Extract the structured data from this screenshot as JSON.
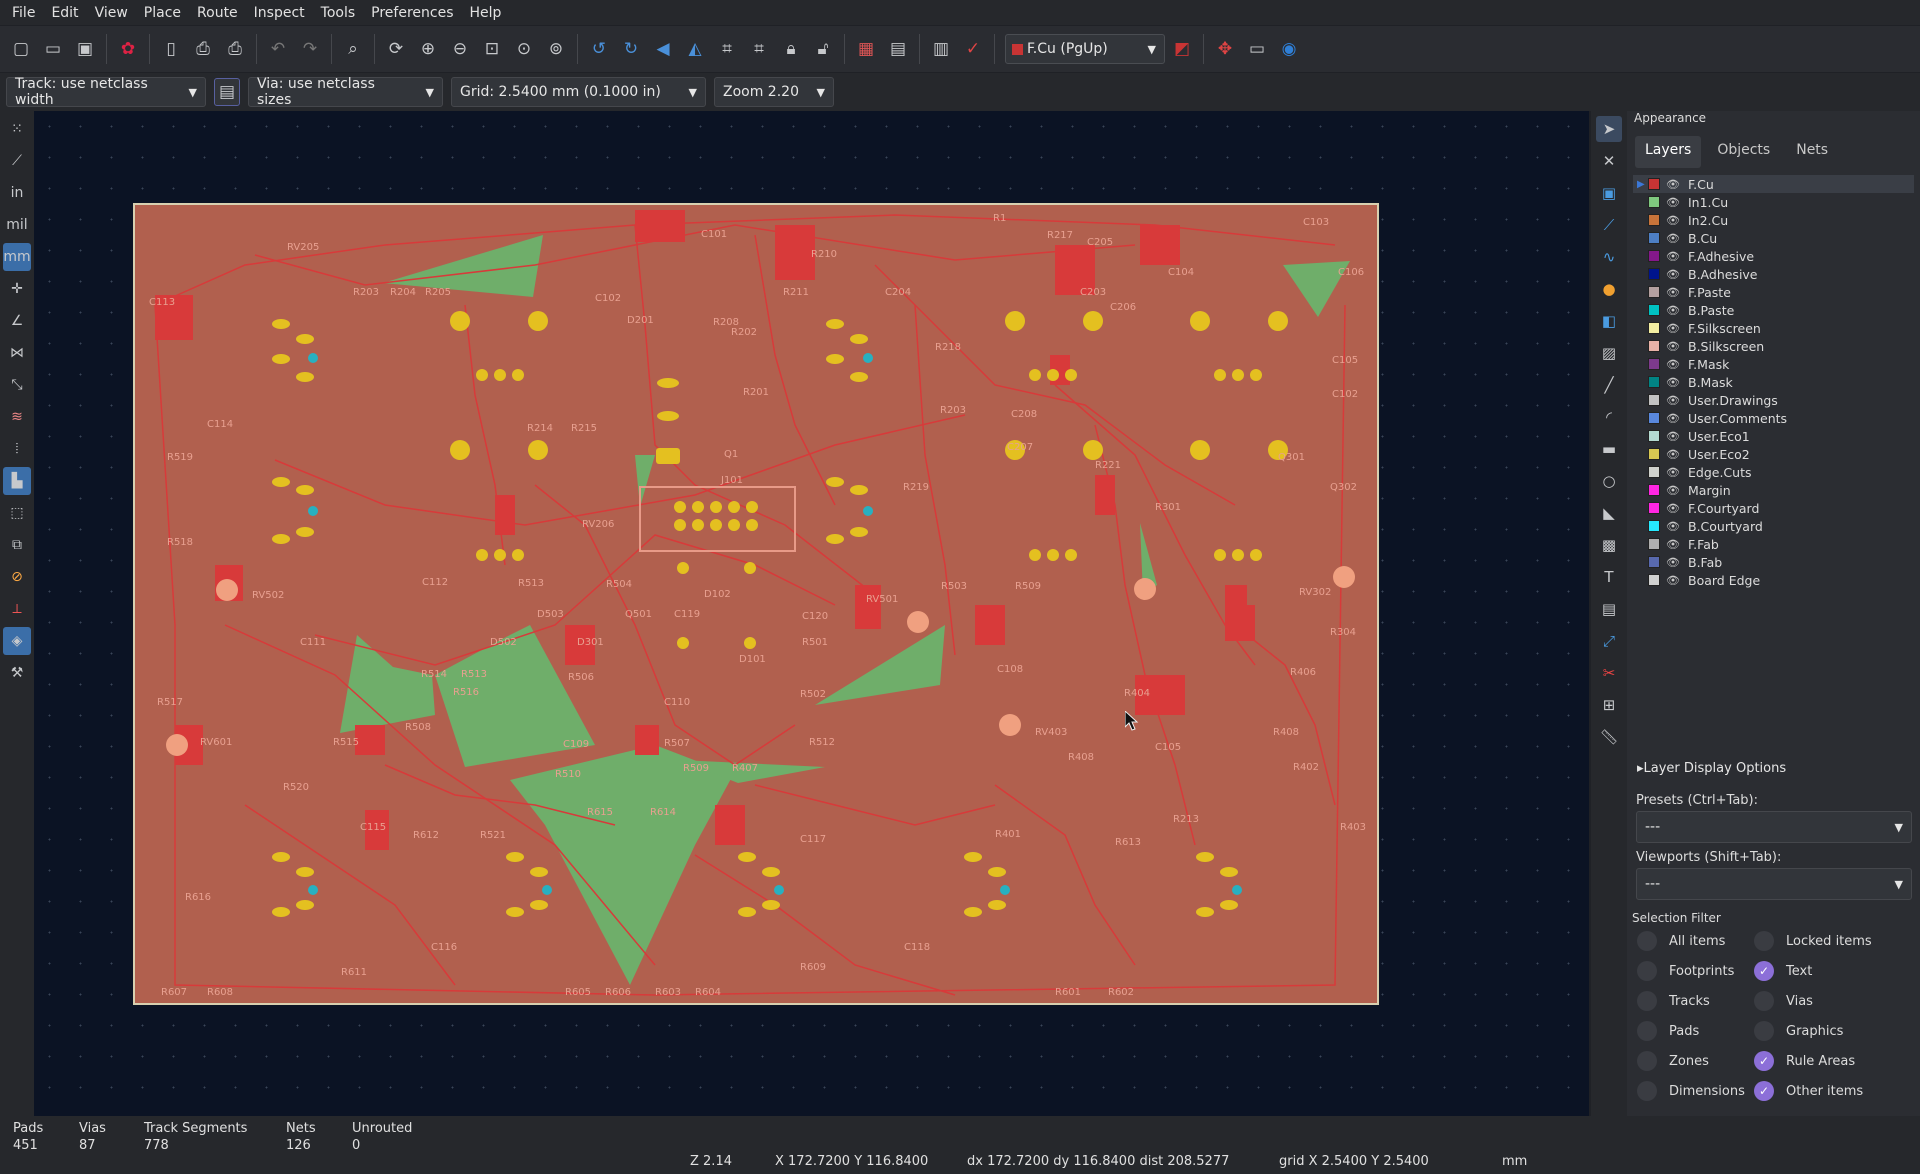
{
  "menu": [
    "File",
    "Edit",
    "View",
    "Place",
    "Route",
    "Inspect",
    "Tools",
    "Preferences",
    "Help"
  ],
  "toolbar": {
    "layer_select": "F.Cu (PgUp)",
    "layer_color": "#c83434"
  },
  "options": {
    "track": "Track: use netclass width",
    "via": "Via: use netclass sizes",
    "grid": "Grid: 2.5400 mm (0.1000 in)",
    "zoom": "Zoom 2.20"
  },
  "left_toolbar": {
    "units_in": "in",
    "units_mil": "mil",
    "units_mm": "mm"
  },
  "appearance": {
    "title": "Appearance",
    "tabs": [
      "Layers",
      "Objects",
      "Nets"
    ],
    "layers": [
      {
        "name": "F.Cu",
        "color": "#c83434"
      },
      {
        "name": "In1.Cu",
        "color": "#7fc87f"
      },
      {
        "name": "In2.Cu",
        "color": "#c8743a"
      },
      {
        "name": "B.Cu",
        "color": "#4d7fc4"
      },
      {
        "name": "F.Adhesive",
        "color": "#84188a"
      },
      {
        "name": "B.Adhesive",
        "color": "#00148c"
      },
      {
        "name": "F.Paste",
        "color": "#b4a0a0"
      },
      {
        "name": "B.Paste",
        "color": "#00c2c2"
      },
      {
        "name": "F.Silkscreen",
        "color": "#f2eda1"
      },
      {
        "name": "B.Silkscreen",
        "color": "#e8b2a7"
      },
      {
        "name": "F.Mask",
        "color": "#7d3a8c"
      },
      {
        "name": "B.Mask",
        "color": "#018484"
      },
      {
        "name": "User.Drawings",
        "color": "#c2c2c2"
      },
      {
        "name": "User.Comments",
        "color": "#5988dd"
      },
      {
        "name": "User.Eco1",
        "color": "#b4dbd2"
      },
      {
        "name": "User.Eco2",
        "color": "#d8c852"
      },
      {
        "name": "Edge.Cuts",
        "color": "#d0d2cd"
      },
      {
        "name": "Margin",
        "color": "#ff26e2"
      },
      {
        "name": "F.Courtyard",
        "color": "#ff26e2"
      },
      {
        "name": "B.Courtyard",
        "color": "#26e9ff"
      },
      {
        "name": "F.Fab",
        "color": "#afafaf"
      },
      {
        "name": "B.Fab",
        "color": "#5869ae"
      },
      {
        "name": "Board Edge",
        "color": "#d0d0d0"
      }
    ],
    "layer_display_options": "Layer Display Options",
    "presets_label": "Presets (Ctrl+Tab):",
    "presets_value": "---",
    "viewports_label": "Viewports (Shift+Tab):",
    "viewports_value": "---",
    "selection_filter_label": "Selection Filter",
    "selection_filter": [
      {
        "label": "All items",
        "checked": false
      },
      {
        "label": "Locked items",
        "checked": false
      },
      {
        "label": "Footprints",
        "checked": false
      },
      {
        "label": "Text",
        "checked": true
      },
      {
        "label": "Tracks",
        "checked": false
      },
      {
        "label": "Vias",
        "checked": false
      },
      {
        "label": "Pads",
        "checked": false
      },
      {
        "label": "Graphics",
        "checked": false
      },
      {
        "label": "Zones",
        "checked": false
      },
      {
        "label": "Rule Areas",
        "checked": true
      },
      {
        "label": "Dimensions",
        "checked": false
      },
      {
        "label": "Other items",
        "checked": true
      }
    ]
  },
  "board_labels": [
    "RV205",
    "R203",
    "R204",
    "R205",
    "C113",
    "C114",
    "R519",
    "R518",
    "RV502",
    "C111",
    "R517",
    "RV601",
    "R515",
    "R520",
    "R616",
    "C115",
    "R612",
    "R521",
    "C116",
    "R611",
    "R607",
    "R608",
    "C101",
    "C102",
    "D201",
    "R202",
    "R208",
    "R201",
    "R211",
    "R210",
    "R214",
    "R215",
    "RV206",
    "J101",
    "C112",
    "R504",
    "R513",
    "D502",
    "D503",
    "D301",
    "Q501",
    "C119",
    "D102",
    "D101",
    "R516",
    "R514",
    "R513",
    "R506",
    "R508",
    "C110",
    "C109",
    "R510",
    "R615",
    "R614",
    "R507",
    "R509",
    "R407",
    "R512",
    "R502",
    "R501",
    "C120",
    "RV501",
    "R503",
    "R509",
    "C117",
    "C118",
    "R609",
    "R605",
    "R606",
    "R603",
    "R604",
    "R1",
    "R217",
    "C205",
    "C203",
    "C204",
    "R218",
    "R203",
    "C207",
    "C208",
    "R219",
    "R221",
    "C206",
    "C104",
    "C103",
    "C106",
    "C105",
    "C102",
    "RV302",
    "R304",
    "R301",
    "Q301",
    "Q302",
    "C108",
    "R404",
    "RV403",
    "R408",
    "C105",
    "R406",
    "R408",
    "R213",
    "R613",
    "R403",
    "R401",
    "R402",
    "R601",
    "R602",
    "Q1"
  ],
  "status": {
    "pads_label": "Pads",
    "pads": "451",
    "vias_label": "Vias",
    "vias": "87",
    "tracks_label": "Track Segments",
    "tracks": "778",
    "nets_label": "Nets",
    "nets": "126",
    "unrouted_label": "Unrouted",
    "unrouted": "0",
    "z": "Z 2.14",
    "xy": "X 172.7200  Y 116.8400",
    "delta": "dx 172.7200  dy 116.8400  dist 208.5277",
    "grid": "grid X 2.5400  Y 2.5400",
    "units": "mm"
  }
}
